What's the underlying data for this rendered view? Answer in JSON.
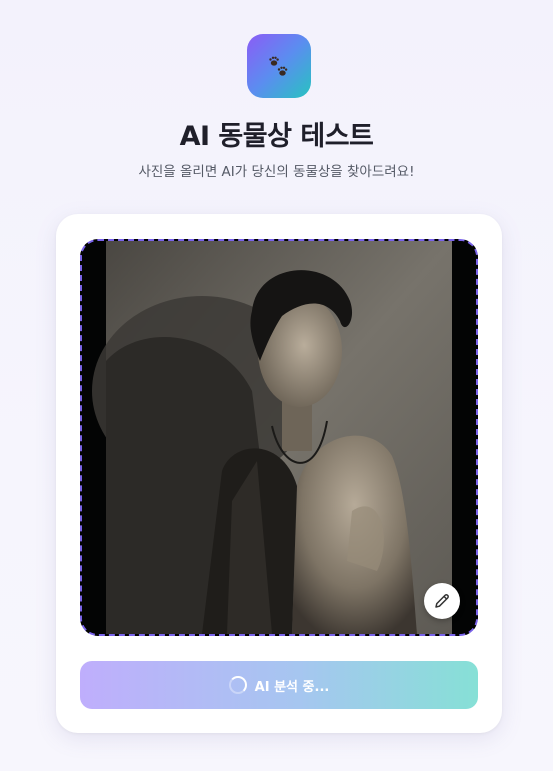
{
  "header": {
    "logo_icon": "paw-icon",
    "title": "AI 동물상 테스트",
    "subtitle": "사진을 올리면 AI가 당신의 동물상을 찾아드려요!"
  },
  "upload": {
    "state": "image-uploaded",
    "edit_icon": "pencil-icon"
  },
  "analyze_button": {
    "label": "AI 분석 중...",
    "icon": "spinner-icon",
    "state": "loading"
  },
  "colors": {
    "accent_purple": "#7a63ea",
    "gradient_start": "#bfaefc",
    "gradient_end": "#86e0d6"
  }
}
